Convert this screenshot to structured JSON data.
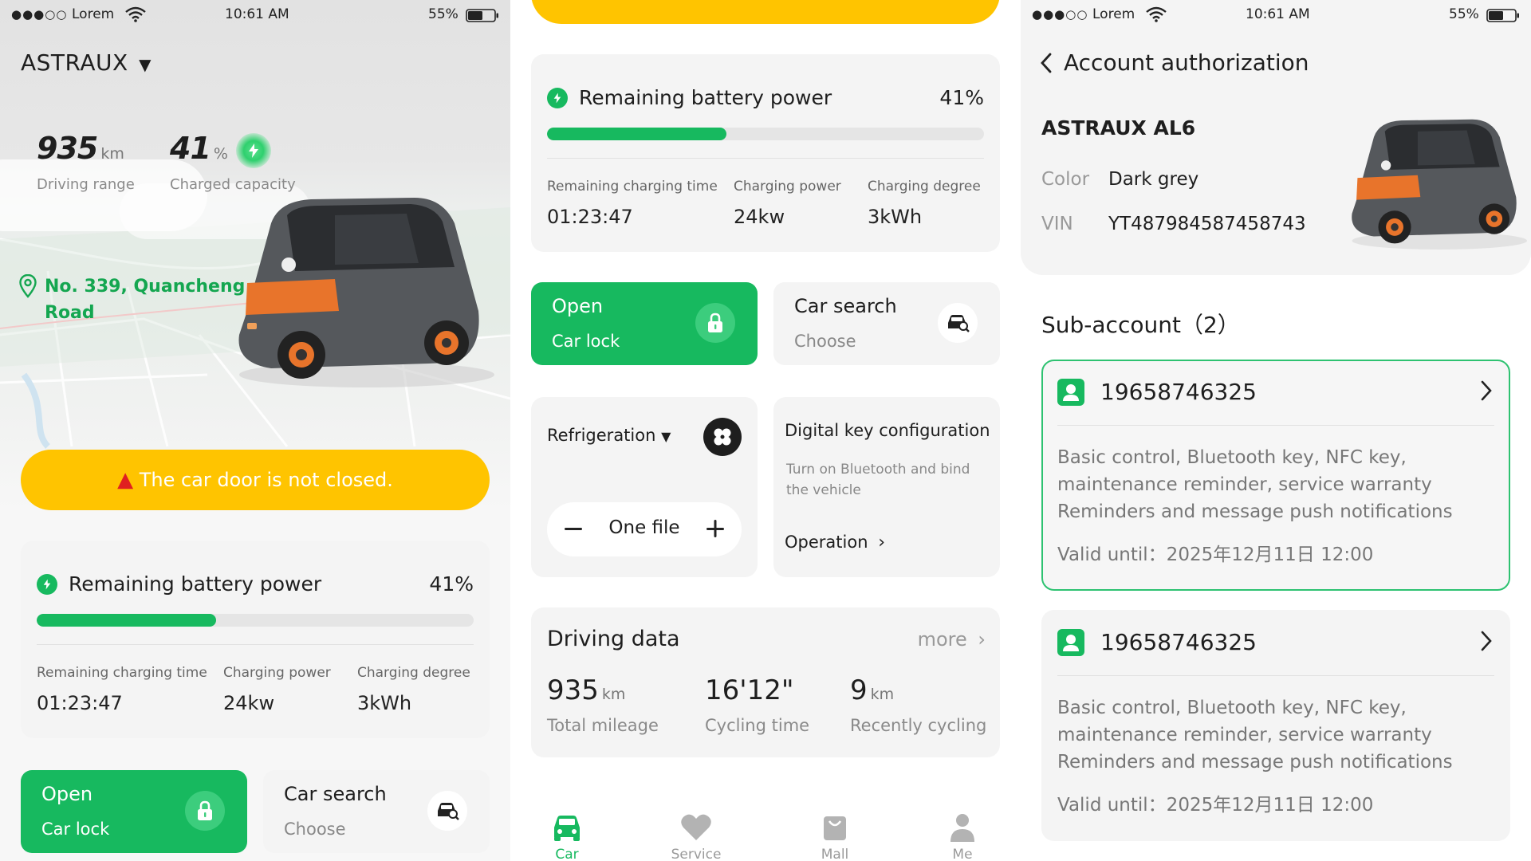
{
  "status_bar": {
    "carrier": "Lorem",
    "time": "10:61 AM",
    "battery": "55%"
  },
  "home": {
    "car_name": "ASTRAUX",
    "driving_range_value": "935",
    "driving_range_unit": "km",
    "driving_range_label": "Driving range",
    "charge_value": "41",
    "charge_unit": "%",
    "charge_label": "Charged capacity",
    "location": "No. 339, Quancheng Road",
    "warning": "The car door is not closed."
  },
  "battery_card": {
    "title": "Remaining battery power",
    "percent_text": "41%",
    "level": 0.41,
    "charging_time_label": "Remaining charging time",
    "charging_time_value": "01:23:47",
    "charging_power_label": "Charging power",
    "charging_power_value": "24kw",
    "charging_degree_label": "Charging degree",
    "charging_degree_value": "3kWh"
  },
  "actions": {
    "lock_title": "Open",
    "lock_sub": "Car lock",
    "search_title": "Car search",
    "search_sub": "Choose"
  },
  "climate": {
    "mode": "Refrigeration",
    "level": "One file"
  },
  "digital_key": {
    "title": "Digital key configuration",
    "description": "Turn on Bluetooth and bind the vehicle",
    "operation": "Operation"
  },
  "driving_data": {
    "title": "Driving data",
    "more": "more",
    "mileage_value": "935",
    "mileage_unit": "km",
    "mileage_label": "Total mileage",
    "time_value": "16'12\"",
    "time_label": "Cycling time",
    "recent_value": "9",
    "recent_unit": "km",
    "recent_label": "Recently cycling"
  },
  "tabs": [
    "Car",
    "Service",
    "Mall",
    "Me"
  ],
  "authorization": {
    "header": "Account authorization",
    "model": "ASTRAUX AL6",
    "color_label": "Color",
    "color_value": "Dark grey",
    "vin_label": "VIN",
    "vin_value": "YT487984587458743",
    "sub_title": "Sub-account（2）",
    "accounts": [
      {
        "phone": "19658746325",
        "permissions_1": "Basic control, Bluetooth key, NFC key,",
        "permissions_2": "maintenance reminder, service warranty",
        "permissions_3": "Reminders and message push notifications",
        "valid": "Valid until：2025年12月11日 12:00"
      },
      {
        "phone": "19658746325",
        "permissions_1": "Basic control, Bluetooth key, NFC key,",
        "permissions_2": "maintenance reminder, service warranty",
        "permissions_3": "Reminders and message push notifications",
        "valid": "Valid until：2025年12月11日 12:00"
      }
    ]
  },
  "colors": {
    "accent": "#17b95f",
    "warning": "#ffc400",
    "card": "#f4f4f4"
  }
}
